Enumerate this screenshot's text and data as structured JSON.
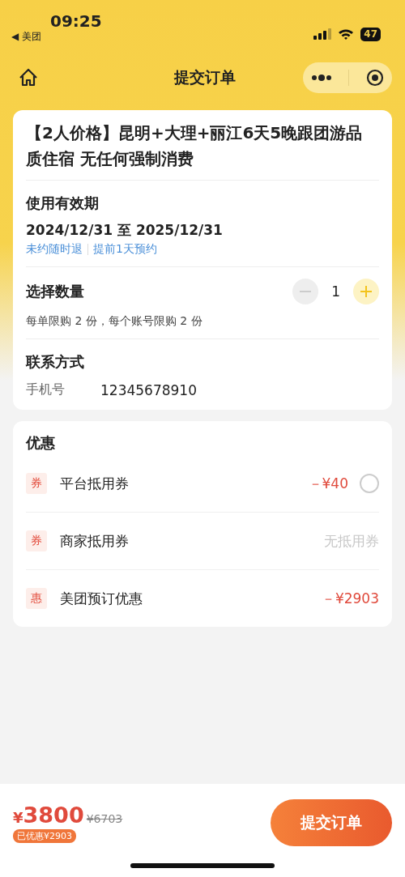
{
  "status_bar": {
    "time": "09:25",
    "back_app": "◀ 美团",
    "battery": "47"
  },
  "nav": {
    "title": "提交订单"
  },
  "product": {
    "title": "【2人价格】昆明+大理+丽江6天5晚跟团游品质住宿 无任何强制消费"
  },
  "validity": {
    "label": "使用有效期",
    "dates": "2024/12/31 至 2025/12/31",
    "tags": [
      "未约随时退",
      "提前1天预约"
    ]
  },
  "quantity": {
    "label": "选择数量",
    "value": "1",
    "minus_disabled": true,
    "limit": "每单限购 2 份，每个账号限购 2 份"
  },
  "contact": {
    "label": "联系方式",
    "field": "手机号",
    "value": "12345678910"
  },
  "discounts": {
    "title": "优惠",
    "items": [
      {
        "badge": "券",
        "name": "平台抵用券",
        "kind": "amount",
        "value": "－¥40",
        "selected": false
      },
      {
        "badge": "券",
        "name": "商家抵用券",
        "kind": "none",
        "value": "无抵用券"
      },
      {
        "badge": "惠",
        "name": "美团预订优惠",
        "kind": "amount",
        "value": "－¥2903"
      }
    ]
  },
  "footer": {
    "currency": "¥",
    "price": "3800",
    "original": "¥6703",
    "saved": "已优惠¥2903",
    "submit": "提交订单"
  }
}
